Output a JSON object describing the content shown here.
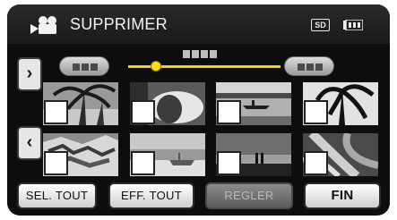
{
  "header": {
    "title": "SUPPRIMER",
    "media_badge": "SD",
    "mode_icon": "video-camera-icon",
    "battery_icon": "battery-icon"
  },
  "navigation": {
    "prev_page_icon": "chevron-left-icon",
    "next_page_icon": "chevron-right-icon",
    "slider_position": 0.18
  },
  "thumbnails": [
    {
      "row": 1,
      "scene": "palm-beach",
      "checked": false
    },
    {
      "row": 1,
      "scene": "portrait-hat",
      "checked": false
    },
    {
      "row": 1,
      "scene": "boat-lake",
      "checked": false
    },
    {
      "row": 1,
      "scene": "palm-silhouette",
      "checked": false
    },
    {
      "row": 2,
      "scene": "rocky-coast",
      "checked": false
    },
    {
      "row": 2,
      "scene": "harbor-boats",
      "checked": false
    },
    {
      "row": 2,
      "scene": "sunset-couple",
      "checked": false
    },
    {
      "row": 2,
      "scene": "tropical-leaves",
      "checked": false
    }
  ],
  "buttons": {
    "select_all": "SEL. TOUT",
    "clear_all": "EFF. TOUT",
    "set": "REGLER",
    "done": "FIN"
  },
  "colors": {
    "slider_accent": "#ffe000",
    "background": "#0d0d0d"
  }
}
